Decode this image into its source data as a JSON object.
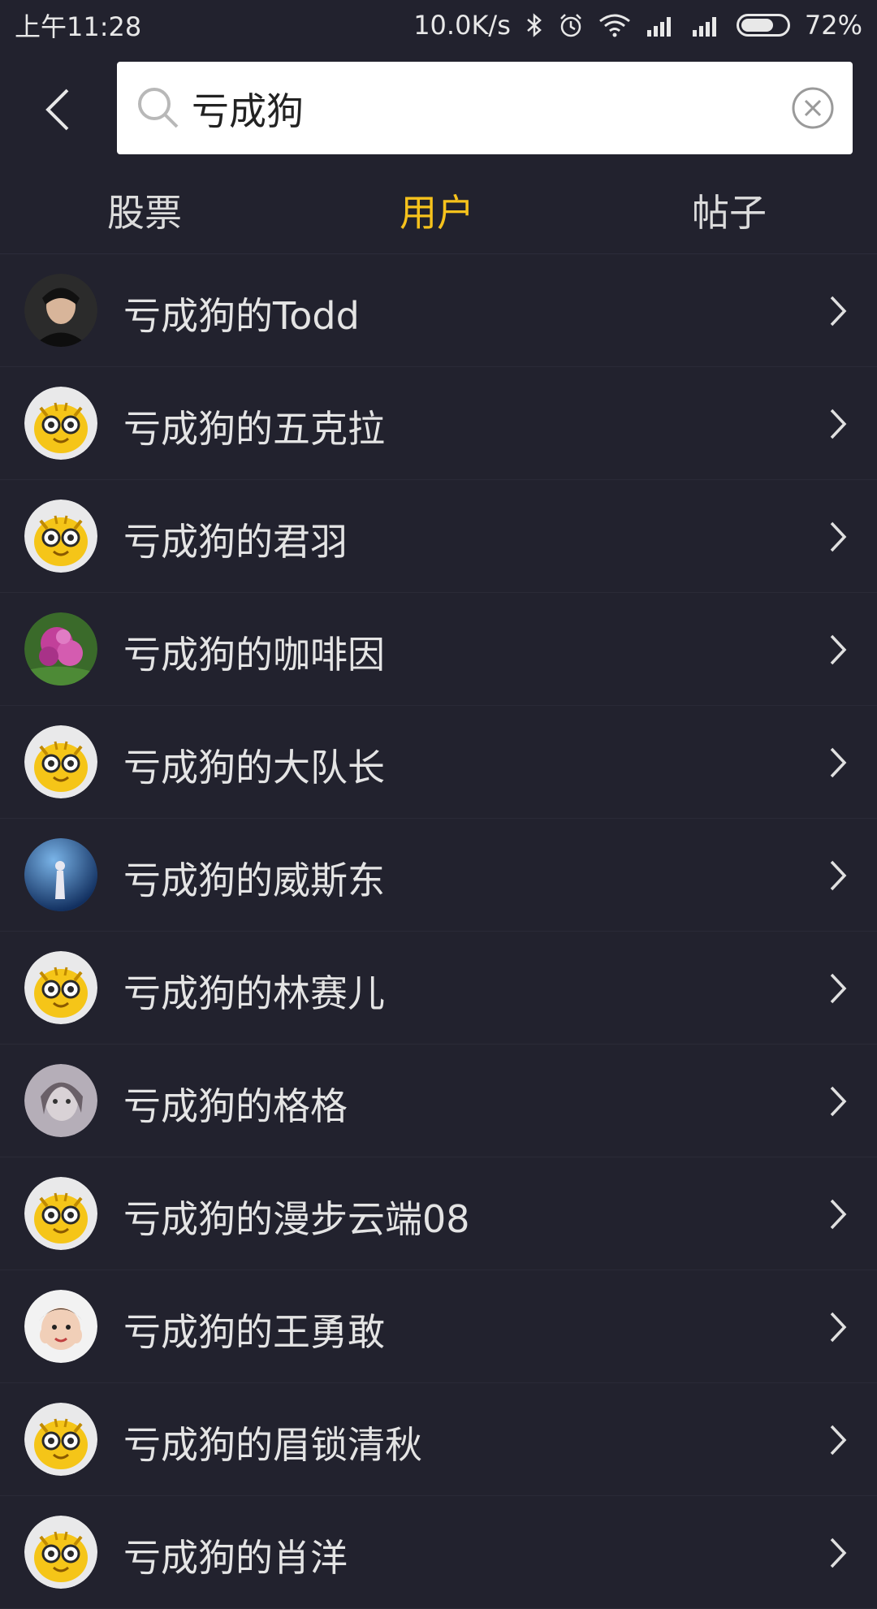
{
  "status_bar": {
    "time": "上午11:28",
    "net_speed": "10.0K/s",
    "battery_pct": "72%",
    "battery_level": 0.72,
    "icons": [
      "bluetooth-icon",
      "alarm-icon",
      "wifi-icon",
      "signal-icon",
      "signal-icon",
      "battery-icon"
    ]
  },
  "search": {
    "value": "亏成狗",
    "placeholder": ""
  },
  "tabs": [
    {
      "label": "股票",
      "active": false
    },
    {
      "label": "用户",
      "active": true
    },
    {
      "label": "帖子",
      "active": false
    }
  ],
  "users": [
    {
      "name": "亏成狗的Todd",
      "avatar": "photo-dark"
    },
    {
      "name": "亏成狗的五克拉",
      "avatar": "tiger"
    },
    {
      "name": "亏成狗的君羽",
      "avatar": "tiger"
    },
    {
      "name": "亏成狗的咖啡因",
      "avatar": "photo-flower"
    },
    {
      "name": "亏成狗的大队长",
      "avatar": "tiger"
    },
    {
      "name": "亏成狗的威斯东",
      "avatar": "photo-blue"
    },
    {
      "name": "亏成狗的林赛儿",
      "avatar": "tiger"
    },
    {
      "name": "亏成狗的格格",
      "avatar": "photo-gray"
    },
    {
      "name": "亏成狗的漫步云端08",
      "avatar": "tiger"
    },
    {
      "name": "亏成狗的王勇敢",
      "avatar": "photo-child"
    },
    {
      "name": "亏成狗的眉锁清秋",
      "avatar": "tiger"
    },
    {
      "name": "亏成狗的肖洋",
      "avatar": "tiger"
    }
  ],
  "colors": {
    "background": "#22222e",
    "accent": "#f6c21c",
    "text": "#e4e4e4"
  }
}
